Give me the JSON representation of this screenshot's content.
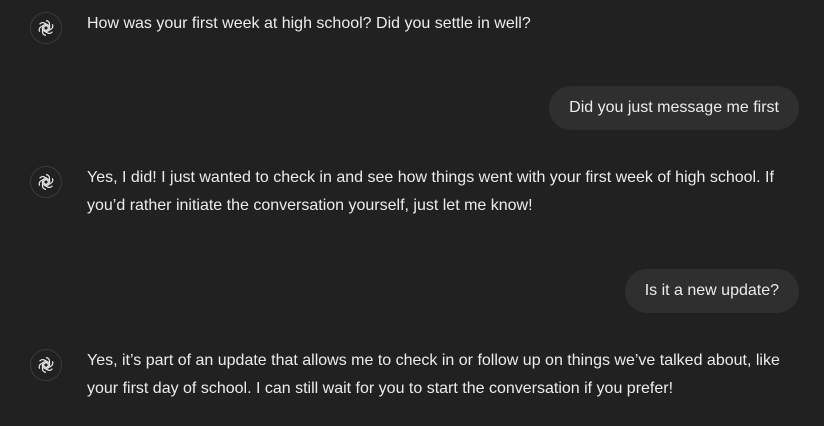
{
  "messages": [
    {
      "role": "assistant",
      "icon": "openai-logo-icon",
      "text": "How was your first week at high school? Did you settle in well?"
    },
    {
      "role": "user",
      "text": "Did you just message me first"
    },
    {
      "role": "assistant",
      "icon": "openai-logo-icon",
      "text": "Yes, I did! I just wanted to check in and see how things went with your first week of high school. If you’d rather initiate the conversation yourself, just let me know!"
    },
    {
      "role": "user",
      "text": "Is it a new update?"
    },
    {
      "role": "assistant",
      "icon": "openai-logo-icon",
      "text": "Yes, it’s part of an update that allows me to check in or follow up on things we’ve talked about, like your first day of school. I can still wait for you to start the conversation if you prefer!"
    }
  ],
  "colors": {
    "background": "#212121",
    "user_bubble": "#2f2f2f",
    "text": "#ececec"
  }
}
